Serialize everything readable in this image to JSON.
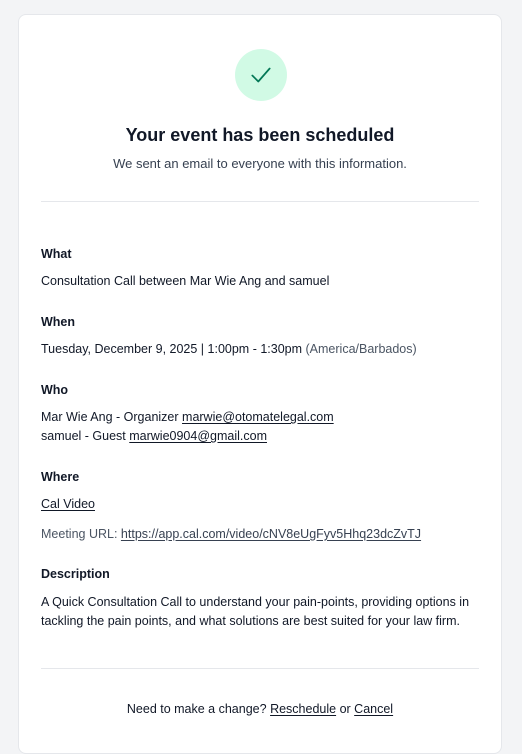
{
  "header": {
    "title": "Your event has been scheduled",
    "subtitle": "We sent an email to everyone with this information."
  },
  "what": {
    "label": "What",
    "value": "Consultation Call between Mar Wie Ang and samuel"
  },
  "when": {
    "label": "When",
    "value": "Tuesday, December 9, 2025 | 1:00pm - 1:30pm",
    "timezone": "(America/Barbados)"
  },
  "who": {
    "label": "Who",
    "attendees": [
      {
        "text": "Mar Wie Ang - Organizer",
        "email": "marwie@otomatelegal.com"
      },
      {
        "text": "samuel - Guest",
        "email": "marwie0904@gmail.com"
      }
    ]
  },
  "where": {
    "label": "Where",
    "location": "Cal Video",
    "meeting_url_label": "Meeting URL:",
    "meeting_url": "https://app.cal.com/video/cNV8eUgFyv5Hhq23dcZvTJ"
  },
  "description": {
    "label": "Description",
    "value": "A Quick Consultation Call to understand your pain-points, providing options in tackling the pain points, and what solutions are best suited for your law firm."
  },
  "footer": {
    "prompt": "Need to make a change?",
    "reschedule": "Reschedule",
    "or": "or",
    "cancel": "Cancel"
  },
  "colors": {
    "success_bg": "#d1fae5",
    "success_check": "#047857"
  },
  "icons": {
    "status": "check-icon"
  }
}
